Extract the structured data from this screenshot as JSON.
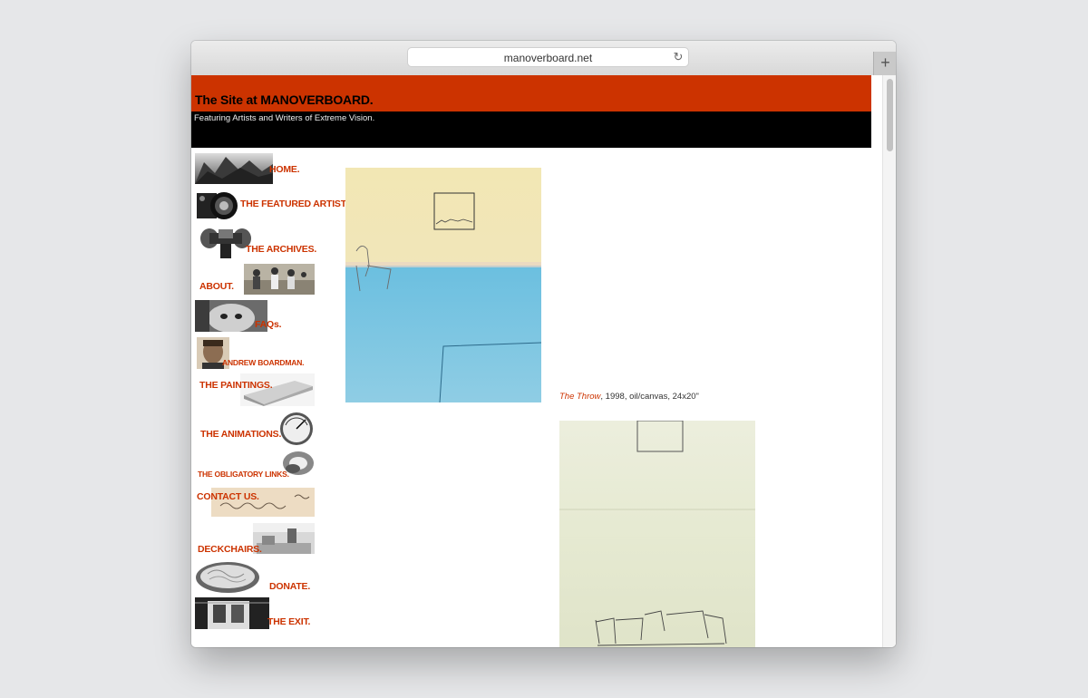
{
  "browser": {
    "url": "manoverboard.net"
  },
  "site": {
    "title": "The Site at MANOVERBOARD.",
    "tagline": "Featuring Artists and Writers of Extreme Vision."
  },
  "nav": [
    {
      "label": "HOME."
    },
    {
      "label": "THE FEATURED ARTIST."
    },
    {
      "label": "THE ARCHIVES."
    },
    {
      "label": "ABOUT."
    },
    {
      "label": "FAQs."
    },
    {
      "label": "ANDREW BOARDMAN."
    },
    {
      "label": "THE PAINTINGS."
    },
    {
      "label": "THE ANIMATIONS."
    },
    {
      "label": "THE OBLIGATORY LINKS."
    },
    {
      "label": "CONTACT US."
    },
    {
      "label": "DECKCHAIRS."
    },
    {
      "label": "DONATE."
    },
    {
      "label": "THE EXIT."
    }
  ],
  "artworks": [
    {
      "title": "The Throw",
      "details": ", 1998, oil/canvas, 24x20\""
    }
  ],
  "colors": {
    "accent": "#cc3300",
    "header_bar": "#cc3300",
    "tagline_bar": "#000000"
  }
}
